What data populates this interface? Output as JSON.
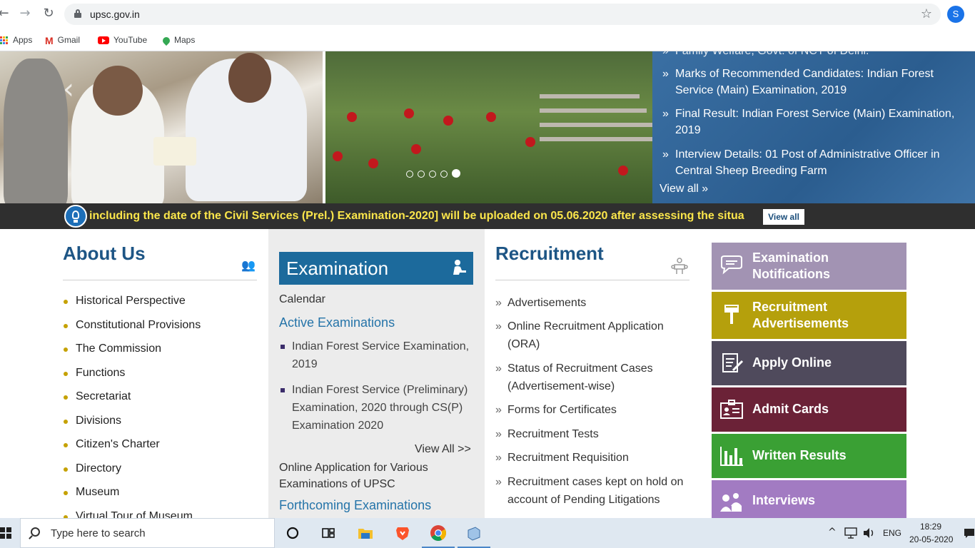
{
  "browser": {
    "url": "upsc.gov.in",
    "profile_initial": "S",
    "bookmarks": [
      {
        "label": "Apps",
        "icon": "apps-grid-icon"
      },
      {
        "label": "Gmail",
        "icon": "gmail-icon"
      },
      {
        "label": "YouTube",
        "icon": "youtube-icon"
      },
      {
        "label": "Maps",
        "icon": "maps-icon"
      }
    ]
  },
  "hero": {
    "news_partial": "Family Welfare, Govt. of NCT of Delhi.",
    "news": [
      "Marks of Recommended Candidates: Indian Forest Service (Main) Examination, 2019",
      "Final Result: Indian Forest Service (Main) Examination, 2019",
      "Interview Details: 01 Post of Administrative Officer in Central Sheep Breeding Farm"
    ],
    "view_all": "View all »",
    "slide_count": 5,
    "active_slide": 5
  },
  "ticker": {
    "text": "including the date of the Civil Services (Prel.) Examination-2020] will be uploaded on 05.06.2020 after assessing the situa",
    "button": "View all"
  },
  "about": {
    "title": "About Us",
    "items": [
      "Historical Perspective",
      "Constitutional Provisions",
      "The Commission",
      "Functions",
      "Secretariat",
      "Divisions",
      "Citizen's Charter",
      "Directory",
      "Museum",
      "Virtual Tour of Museum"
    ]
  },
  "examination": {
    "title": "Examination",
    "calendar": "Calendar",
    "active_heading": "Active Examinations",
    "active_items": [
      "Indian Forest Service Examination, 2019",
      "Indian Forest Service (Preliminary) Examination, 2020 through CS(P) Examination 2020"
    ],
    "view_all": "View All >>",
    "online_application": "Online Application for Various Examinations of UPSC",
    "forthcoming_heading": "Forthcoming Examinations"
  },
  "recruitment": {
    "title": "Recruitment",
    "items": [
      "Advertisements",
      "Online Recruitment Application (ORA)",
      "Status of Recruitment Cases (Advertisement-wise)",
      "Forms for Certificates",
      "Recruitment Tests",
      "Recruitment Requisition",
      "Recruitment cases kept on hold on account of Pending Litigations"
    ]
  },
  "tiles": [
    {
      "label": "Examination Notifications",
      "color": "#a293b3",
      "icon": "speech-bubble-icon"
    },
    {
      "label": "Recruitment Advertisements",
      "color": "#b5a00c",
      "icon": "signboard-icon"
    },
    {
      "label": "Apply Online",
      "color": "#4f4a5c",
      "icon": "form-pen-icon"
    },
    {
      "label": "Admit Cards",
      "color": "#6b2237",
      "icon": "id-card-icon"
    },
    {
      "label": "Written Results",
      "color": "#3aa034",
      "icon": "bar-chart-icon"
    },
    {
      "label": "Interviews",
      "color": "#a27bc2",
      "icon": "people-icon"
    }
  ],
  "taskbar": {
    "search_placeholder": "Type here to search",
    "language": "ENG",
    "time": "18:29",
    "date": "20-05-2020"
  }
}
